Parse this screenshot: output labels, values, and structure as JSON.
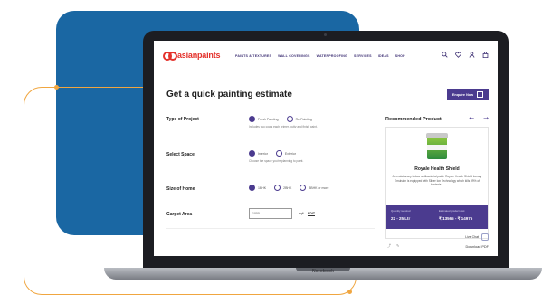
{
  "device_label": "Notebook",
  "brand": {
    "logo_text": "asianpaints",
    "accent": "#e4312b",
    "primary": "#4b3b8f"
  },
  "nav": {
    "items": [
      "PAINTS & TEXTURES",
      "WALL COVERINGS",
      "WATERPROOFING",
      "SERVICES",
      "IDEAS",
      "SHOP"
    ],
    "icons": [
      "search-icon",
      "heart-icon",
      "user-icon",
      "bag-icon"
    ]
  },
  "page_title": "Get a quick painting estimate",
  "enquire_label": "Enquire Now",
  "form": {
    "project": {
      "label": "Type of Project",
      "options": [
        "Fresh Painting",
        "Re-Painting"
      ],
      "selected": "Fresh Painting",
      "hint": "Includes two coats each primer, putty and finish paint."
    },
    "space": {
      "label": "Select Space",
      "options": [
        "Interior",
        "Exterior"
      ],
      "selected": "Interior",
      "hint": "Choose the space you're planning to paint."
    },
    "home_size": {
      "label": "Size of Home",
      "options": [
        "1BHK",
        "2BHK",
        "3BHK or more"
      ],
      "selected": "1BHK"
    },
    "carpet_area": {
      "label": "Carpet Area",
      "value": "1000",
      "unit": "sqft",
      "edit_label": "EDIT"
    }
  },
  "recommended": {
    "heading": "Recommended Product",
    "product_name": "Royale Health Shield",
    "description": "A revolutionary indoor antibacterial paint. Royale Health Shield Luxury Emulsion is equipped with Silver Ion Technology which kills 99% of bacteria...",
    "qty_label": "Quantity required",
    "qty_value": "22 - 25 Ltr",
    "price_label": "Estimated product cost",
    "price_value": "₹ 13565 - ₹ 14975"
  },
  "cta_label": "Live Chat",
  "download_label": "Download PDF"
}
